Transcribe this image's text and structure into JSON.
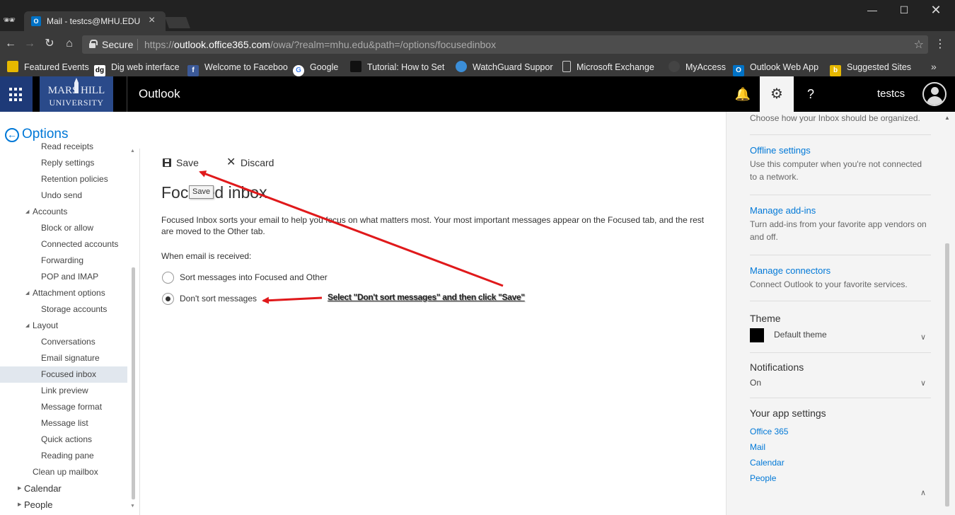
{
  "browser": {
    "tab_title": "Mail - testcs@MHU.EDU",
    "tab_favicon": "outlook-icon",
    "secure_label": "Secure",
    "url_scheme": "https://",
    "url_host": "outlook.office365.com",
    "url_path": "/owa/?realm=mhu.edu&path=/options/focusedinbox",
    "bookmarks": [
      {
        "label": "Featured Events",
        "icon": "bookmark-icon-featured",
        "color": "#e6b800"
      },
      {
        "label": "Dig web interface",
        "icon": "dig-icon",
        "color": "#ffffff"
      },
      {
        "label": "Welcome to Faceboo",
        "icon": "facebook-icon",
        "color": "#3b5998"
      },
      {
        "label": "Google",
        "icon": "google-icon",
        "color": "#ffffff"
      },
      {
        "label": "Tutorial: How to Set",
        "icon": "tutorial-icon",
        "color": "#111111"
      },
      {
        "label": "WatchGuard Suppor",
        "icon": "watchguard-icon",
        "color": "#3b8ed8"
      },
      {
        "label": "Microsoft Exchange",
        "icon": "page-icon",
        "color": "#cccccc"
      },
      {
        "label": "MyAccess",
        "icon": "myaccess-icon",
        "color": "#444444"
      },
      {
        "label": "Outlook Web App",
        "icon": "outlook-icon",
        "color": "#0072c6"
      },
      {
        "label": "Suggested Sites",
        "icon": "bing-icon",
        "color": "#e6b800"
      }
    ]
  },
  "header": {
    "app_name": "Outlook",
    "logo_top": "MARS HILL",
    "logo_bottom": "UNIVERSITY",
    "username": "testcs",
    "brand_color": "#1e3a78"
  },
  "options": {
    "title": "Options",
    "nav": [
      {
        "label": "Read receipts",
        "level": 2
      },
      {
        "label": "Reply settings",
        "level": 2
      },
      {
        "label": "Retention policies",
        "level": 2
      },
      {
        "label": "Undo send",
        "level": 2
      },
      {
        "label": "Accounts",
        "level": 1,
        "expanded": true
      },
      {
        "label": "Block or allow",
        "level": 2
      },
      {
        "label": "Connected accounts",
        "level": 2
      },
      {
        "label": "Forwarding",
        "level": 2
      },
      {
        "label": "POP and IMAP",
        "level": 2
      },
      {
        "label": "Attachment options",
        "level": 1,
        "expanded": true
      },
      {
        "label": "Storage accounts",
        "level": 2
      },
      {
        "label": "Layout",
        "level": 1,
        "expanded": true
      },
      {
        "label": "Conversations",
        "level": 2
      },
      {
        "label": "Email signature",
        "level": 2
      },
      {
        "label": "Focused inbox",
        "level": 2,
        "selected": true
      },
      {
        "label": "Link preview",
        "level": 2
      },
      {
        "label": "Message format",
        "level": 2
      },
      {
        "label": "Message list",
        "level": 2
      },
      {
        "label": "Quick actions",
        "level": 2
      },
      {
        "label": "Reading pane",
        "level": 2
      },
      {
        "label": "Clean up mailbox",
        "level": 1
      },
      {
        "label": "Calendar",
        "level": 0,
        "collapsed": true
      },
      {
        "label": "People",
        "level": 0,
        "collapsed": true
      }
    ]
  },
  "main": {
    "save_label": "Save",
    "discard_label": "Discard",
    "heading": "Focused inbox",
    "tooltip": "Save",
    "description": "Focused Inbox sorts your email to help you focus on what matters most. Your most important messages appear on the Focused tab, and the rest are moved to the Other tab.",
    "when_label": "When email is received:",
    "options": [
      {
        "label": "Sort messages into Focused and Other",
        "checked": false
      },
      {
        "label": "Don't sort messages",
        "checked": true
      }
    ],
    "annotation": "Select \"Don't sort messages\" and then click \"Save\"",
    "annotation_color": "#e0191b"
  },
  "right_pane": {
    "top_desc": "Choose how your Inbox should be organized.",
    "offline_title": "Offline settings",
    "offline_desc": "Use this computer when you're not connected to a network.",
    "addins_title": "Manage add-ins",
    "addins_desc": "Turn add-ins from your favorite app vendors on and off.",
    "connectors_title": "Manage connectors",
    "connectors_desc": "Connect Outlook to your favorite services.",
    "theme_label": "Theme",
    "theme_value": "Default theme",
    "notifications_label": "Notifications",
    "notifications_value": "On",
    "app_settings_label": "Your app settings",
    "app_links": [
      "Office 365",
      "Mail",
      "Calendar",
      "People"
    ],
    "link_color": "#0078d7"
  }
}
